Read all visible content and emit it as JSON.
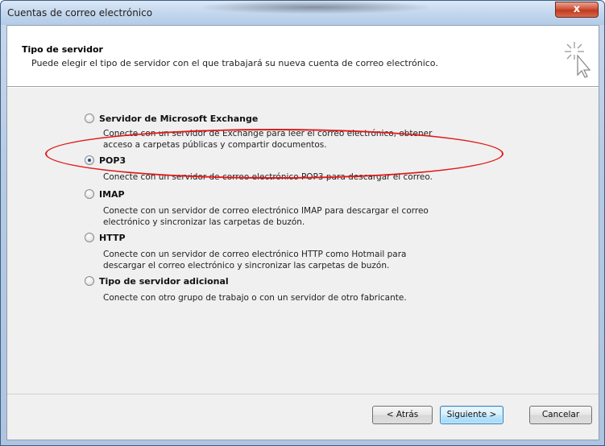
{
  "window": {
    "title": "Cuentas de correo electrónico",
    "close_glyph": "x"
  },
  "header": {
    "title": "Tipo de servidor",
    "subtitle": "Puede elegir el tipo de servidor con el que trabajará su nueva cuenta de correo electrónico.",
    "icon": "wizard-cursor-sparkle-icon"
  },
  "options": [
    {
      "label": "Servidor de Microsoft Exchange",
      "description_lines": [
        "Conecte con un servidor de Exchange para leer el correo electrónico, obtener",
        "acceso a carpetas públicas y compartir documentos."
      ],
      "selected": false
    },
    {
      "label": "POP3",
      "description_lines": [
        "Conecte con un servidor de correo electrónico POP3 para descargar el correo."
      ],
      "selected": true
    },
    {
      "label": "IMAP",
      "description_lines": [
        "Conecte con un servidor de correo electrónico IMAP para descargar el correo",
        "electrónico y sincronizar las carpetas de buzón."
      ],
      "selected": false
    },
    {
      "label": "HTTP",
      "description_lines": [
        "Conecte con un servidor de correo electrónico HTTP como Hotmail para",
        "descargar el correo electrónico y sincronizar las carpetas de buzón."
      ],
      "selected": false
    },
    {
      "label": "Tipo de servidor adicional",
      "description_lines": [
        "Conecte con otro grupo de trabajo o con un servidor de otro fabricante."
      ],
      "selected": false
    }
  ],
  "annotation": {
    "color": "#e01a1a"
  },
  "buttons": {
    "back": "< Atrás",
    "next": "Siguiente >",
    "cancel": "Cancelar"
  }
}
